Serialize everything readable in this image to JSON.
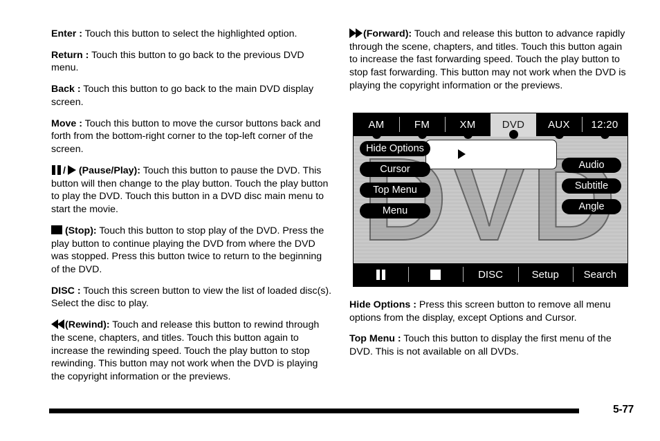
{
  "document": {
    "page_number": "5-77"
  },
  "left_column": {
    "paragraphs": [
      {
        "term": "Enter :",
        "text": " Touch this button to select the highlighted option."
      },
      {
        "term": "Return :",
        "text": " Touch this button to go back to the previous DVD menu."
      },
      {
        "term": "Back :",
        "text": " Touch this button to go back to the main DVD display screen."
      },
      {
        "term": "Move :",
        "text": " Touch this button to move the cursor buttons back and forth from the bottom-right corner to the top-left corner of the screen."
      },
      {
        "icon": "pause-play-icon",
        "term": "(Pause/Play):",
        "text": " Touch this button to pause the DVD. This button will then change to the play button. Touch the play button to play the DVD. Touch this button in a DVD disc main menu to start the movie."
      },
      {
        "icon": "stop-icon",
        "term": "(Stop):",
        "text": " Touch this button to stop play of the DVD. Press the play button to continue playing the DVD from where the DVD was stopped. Press this button twice to return to the beginning of the DVD."
      },
      {
        "term": "DISC :",
        "text": " Touch this screen button to view the list of loaded disc(s). Select the disc to play."
      },
      {
        "icon": "rewind-icon",
        "term": "(Rewind):",
        "text": "  Touch and release this button to rewind through the scene, chapters, and titles. Touch this button again to increase the rewinding speed. Touch the play button to stop rewinding. This button may not work when the DVD is playing the copyright information or the previews."
      }
    ]
  },
  "right_column": {
    "paragraphs_top": [
      {
        "icon": "fast-forward-icon",
        "term": "(Forward):",
        "text": " Touch and release this button to advance rapidly through the scene, chapters, and titles. Touch this button again to increase the fast forwarding speed. Touch the play button to stop fast forwarding. This button may not work when the DVD is playing the copyright information or the previews."
      }
    ],
    "paragraphs_bottom": [
      {
        "term": "Hide Options :",
        "text": " Press this screen button to remove all menu options from the display, except Options and Cursor."
      },
      {
        "term": "Top Menu :",
        "text": " Touch this button to display the first menu of the DVD. This is not available on all DVDs."
      }
    ]
  },
  "dvd_screen": {
    "tabs": [
      {
        "label": "AM",
        "active": false
      },
      {
        "label": "FM",
        "active": false
      },
      {
        "label": "XM",
        "active": false
      },
      {
        "label": "DVD",
        "active": true
      },
      {
        "label": "AUX",
        "active": false
      },
      {
        "label": "12:20",
        "active": false
      }
    ],
    "watermark": "DVD",
    "left_buttons": [
      {
        "label": "Hide Options"
      },
      {
        "label": "Cursor"
      },
      {
        "label": "Top Menu"
      },
      {
        "label": "Menu"
      }
    ],
    "right_buttons": [
      {
        "label": "Audio"
      },
      {
        "label": "Subtitle"
      },
      {
        "label": "Angle"
      }
    ],
    "transport_buttons": [
      {
        "label": "",
        "icon": "pause-icon"
      },
      {
        "label": "",
        "icon": "stop-icon"
      },
      {
        "label": "DISC",
        "icon": ""
      },
      {
        "label": "Setup",
        "icon": ""
      },
      {
        "label": "Search",
        "icon": ""
      }
    ]
  }
}
